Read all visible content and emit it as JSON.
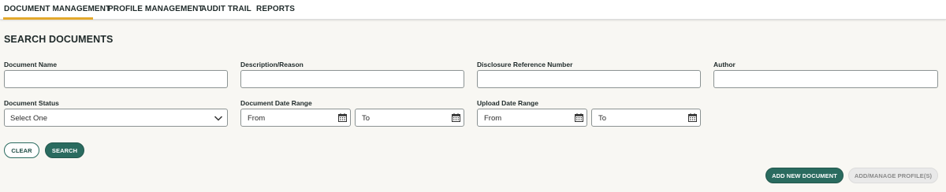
{
  "nav": {
    "tabs": [
      {
        "label": "DOCUMENT MANAGEMENT",
        "active": true
      },
      {
        "label": "PROFILE MANAGEMENT",
        "active": false
      },
      {
        "label": "AUDIT TRAIL",
        "active": false
      },
      {
        "label": "REPORTS",
        "active": false
      }
    ]
  },
  "search": {
    "title": "SEARCH DOCUMENTS",
    "document_name": {
      "label": "Document Name",
      "value": ""
    },
    "description": {
      "label": "Description/Reason",
      "value": ""
    },
    "disclosure": {
      "label": "Disclosure Reference Number",
      "value": ""
    },
    "author": {
      "label": "Author",
      "value": ""
    },
    "status": {
      "label": "Document Status",
      "selected": "Select One"
    },
    "doc_date": {
      "label": "Document Date Range",
      "from": "From",
      "to": "To"
    },
    "upload_date": {
      "label": "Upload Date Range",
      "from": "From",
      "to": "To"
    }
  },
  "actions": {
    "clear": "CLEAR",
    "search": "SEARCH",
    "add_new_document": "ADD NEW DOCUMENT",
    "add_manage_profiles": "ADD/MANAGE PROFILE(S)"
  },
  "colors": {
    "accent_tab": "#e3a82b",
    "primary": "#2a6b5f",
    "background": "#f8f7f3"
  }
}
